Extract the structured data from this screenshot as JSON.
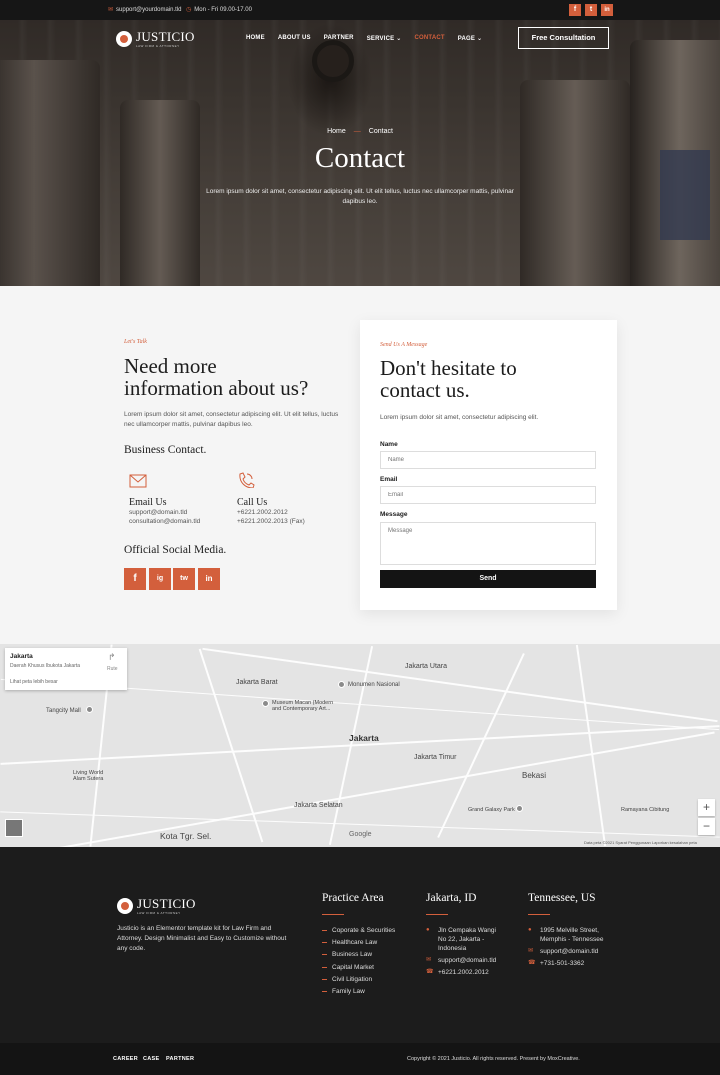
{
  "topbar": {
    "email": "support@yourdomain.tld",
    "hours": "Mon - Fri 09.00-17.00",
    "social": [
      "f",
      "t",
      "in"
    ]
  },
  "brand": {
    "name": "JUSTICIO",
    "tagline": "LAW FIRM & ATTORNEY"
  },
  "nav": {
    "items": [
      "HOME",
      "ABOUT US",
      "PARTNER",
      "SERVICE",
      "CONTACT",
      "PAGE"
    ],
    "cta": "Free Consultation"
  },
  "hero": {
    "breadcrumb_home": "Home",
    "breadcrumb_current": "Contact",
    "title": "Contact",
    "subtitle": "Lorem ipsum dolor sit amet, consectetur adipiscing elit. Ut elit tellus, luctus nec ullamcorper mattis, pulvinar dapibus leo."
  },
  "info": {
    "eyebrow": "Let's Talk",
    "heading_line1": "Need more",
    "heading_line2": "information about us?",
    "text": "Lorem ipsum dolor sit amet, consectetur adipiscing elit. Ut elit tellus, luctus nec ullamcorper mattis, pulvinar dapibus leo.",
    "business_title": "Business Contact.",
    "email_title": "Email Us",
    "email_lines": [
      "support@domain.tld",
      "consultation@domain.tld"
    ],
    "call_title": "Call Us",
    "call_lines": [
      "+6221.2002.2012",
      "+6221.2002.2013 (Fax)"
    ],
    "social_title": "Official Social Media.",
    "social_icons": [
      "f",
      "ig",
      "tw",
      "in"
    ]
  },
  "form": {
    "eyebrow": "Send Us A Message",
    "heading_line1": "Don't hesitate to",
    "heading_line2": "contact us.",
    "text": "Lorem ipsum dolor sit amet, consectetur adipiscing elit.",
    "name_label": "Name",
    "name_placeholder": "Name",
    "email_label": "Email",
    "email_placeholder": "Email",
    "message_label": "Message",
    "message_placeholder": "Message",
    "send": "Send"
  },
  "map": {
    "place_title": "Jakarta",
    "place_sub": "Daerah Khusus Ibukota Jakarta",
    "route": "Rute",
    "larger_map": "Lihat peta lebih besar",
    "labels": {
      "jakarta_utara": "Jakarta Utara",
      "jakarta_barat": "Jakarta Barat",
      "monumen": "Monumen Nasional",
      "museum": "Museum Macan (Modern and Contemporary Art...",
      "tangcity": "Tangcity Mall",
      "jakarta": "Jakarta",
      "jakarta_timur": "Jakarta Timur",
      "bekasi": "Bekasi",
      "living_world": "Living World Alam Sutera",
      "jakarta_selatan": "Jakarta Selatan",
      "grand_galaxy": "Grand Galaxy Park",
      "ramayana": "Ramayana Cibitung",
      "kota_tgr": "Kota Tgr. Sel.",
      "google": "Google"
    },
    "attribution": "Data peta ©2021   Syarat Penggunaan   Laporkan kesalahan peta",
    "zoom_in": "+",
    "zoom_out": "−"
  },
  "footer": {
    "about": "Justicio is an Elementor template kit for Law Firm and Attorney. Design Minimalist and Easy to Customize without any code.",
    "practice_title": "Practice Area",
    "practice_items": [
      "Coporate & Securities",
      "Healthcare Law",
      "Business Law",
      "Capital Market",
      "Civil Litigation",
      "Family Law"
    ],
    "jakarta_title": "Jakarta, ID",
    "jakarta_address": "Jln Cempaka Wangi No 22, Jakarta - Indonesia",
    "jakarta_email": "support@domain.tld",
    "jakarta_phone": "+6221.2002.2012",
    "us_title": "Tennessee, US",
    "us_address": "1995 Melville Street, Memphis - Tennessee",
    "us_email": "support@domain.tld",
    "us_phone": "+731-501-3362"
  },
  "bottom": {
    "links": [
      "CAREER",
      "CASE",
      "PARTNER"
    ],
    "copyright": "Copyright © 2021 Justicio. All rights reserved. Present by MoxCreative."
  },
  "colors": {
    "accent": "#d35f3c",
    "dark": "#1c1c1c",
    "section_bg": "#f5f5f5"
  }
}
